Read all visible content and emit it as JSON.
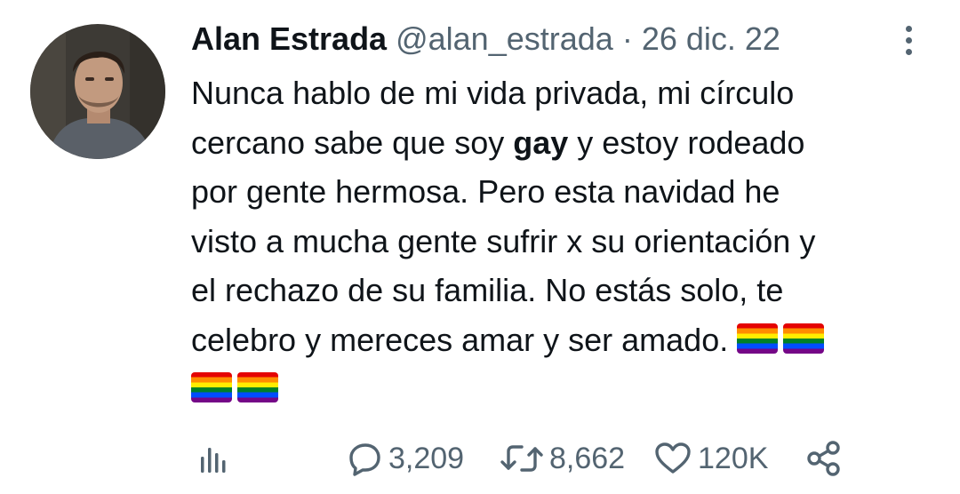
{
  "tweet": {
    "author_name": "Alan Estrada",
    "handle": "@alan_estrada",
    "separator": "·",
    "date": "26 dic. 22",
    "lines": [
      {
        "before": "Nunca hablo de mi vida privada, mi círculo"
      },
      {
        "before": "cercano sabe que soy ",
        "bold": "gay",
        "after": " y estoy rodeado"
      },
      {
        "before": "por gente hermosa. Pero esta navidad he"
      },
      {
        "before": "visto a mucha gente sufrir x su orientación y"
      },
      {
        "before": "el rechazo de su familia. No estás solo, te"
      },
      {
        "before": "celebro y mereces amar y ser amado."
      }
    ],
    "emoji": "rainbow-flag"
  },
  "actions": {
    "replies": "3,209",
    "retweets": "8,662",
    "likes": "120K"
  },
  "icons": {
    "views": "analytics-icon",
    "reply": "reply-icon",
    "retweet": "retweet-icon",
    "like": "heart-icon",
    "share": "share-icon",
    "more": "more-vertical-icon"
  },
  "colors": {
    "text": "#0f1419",
    "secondary": "#536471"
  }
}
